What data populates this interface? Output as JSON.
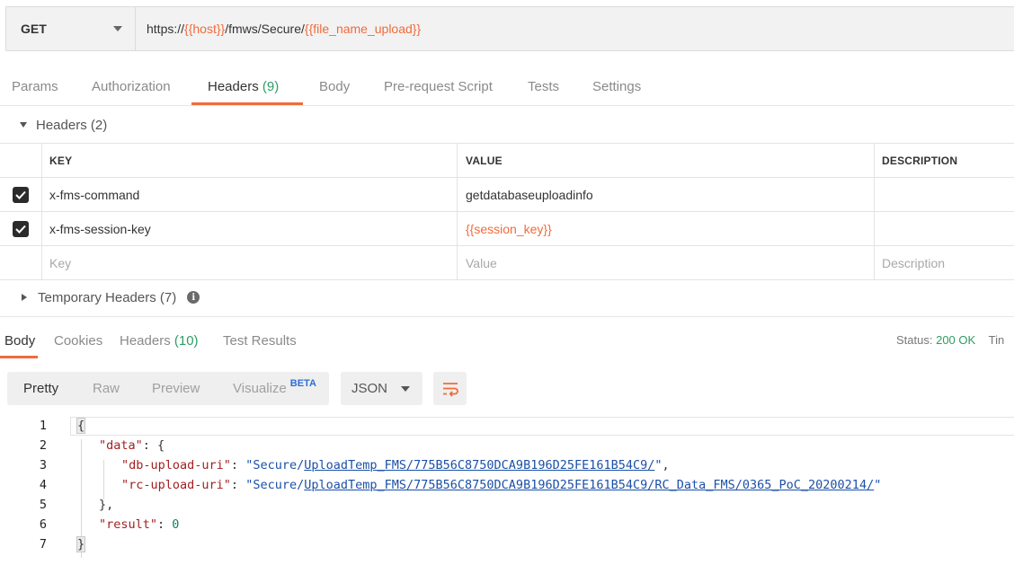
{
  "request": {
    "method": "GET",
    "url_parts": {
      "p1": "https://",
      "v1": "{{host}}",
      "p2": "/fmws/Secure/",
      "v2": "{{file_name_upload}}"
    }
  },
  "request_tabs": {
    "params": "Params",
    "authorization": "Authorization",
    "headers": "Headers",
    "headers_count": "(9)",
    "body": "Body",
    "prerequest": "Pre-request Script",
    "tests": "Tests",
    "settings": "Settings"
  },
  "headers_section": {
    "title": "Headers (2)",
    "columns": {
      "key": "KEY",
      "value": "VALUE",
      "description": "DESCRIPTION"
    },
    "rows": [
      {
        "key": "x-fms-command",
        "value": "getdatabaseuploadinfo",
        "checked": true
      },
      {
        "key": "x-fms-session-key",
        "value": "{{session_key}}",
        "checked": true
      }
    ],
    "placeholder": {
      "key": "Key",
      "value": "Value",
      "description": "Description"
    },
    "temporary": "Temporary Headers (7)"
  },
  "response_tabs": {
    "body": "Body",
    "cookies": "Cookies",
    "headers": "Headers",
    "headers_count": "(10)",
    "test_results": "Test Results"
  },
  "status": {
    "label": "Status:",
    "value": "200 OK",
    "time_label": "Tin"
  },
  "view": {
    "pretty": "Pretty",
    "raw": "Raw",
    "preview": "Preview",
    "visualize": "Visualize",
    "beta": "BETA",
    "format": "JSON"
  },
  "code": {
    "line_numbers": [
      "1",
      "2",
      "3",
      "4",
      "5",
      "6",
      "7"
    ],
    "open_brace": "{",
    "data_key": "\"data\"",
    "data_open": ": {",
    "db_key": "\"db-upload-uri\"",
    "colon": ": ",
    "quote": "\"",
    "db_prefix": "Secure/",
    "db_link": "UploadTemp_FMS/775B56C8750DCA9B196D25FE161B54C9/",
    "comma": ",",
    "rc_key": "\"rc-upload-uri\"",
    "rc_prefix": "Secure/",
    "rc_link": "UploadTemp_FMS/775B56C8750DCA9B196D25FE161B54C9/RC_Data_FMS/0365_PoC_20200214/",
    "data_close": "},",
    "result_key": "\"result\"",
    "result_value": "0",
    "close_brace": "}"
  },
  "colors": {
    "accent": "#f26b3a",
    "count_green": "#2c9e64",
    "string_blue": "#1b50a8",
    "key_red": "#a31f1f"
  }
}
